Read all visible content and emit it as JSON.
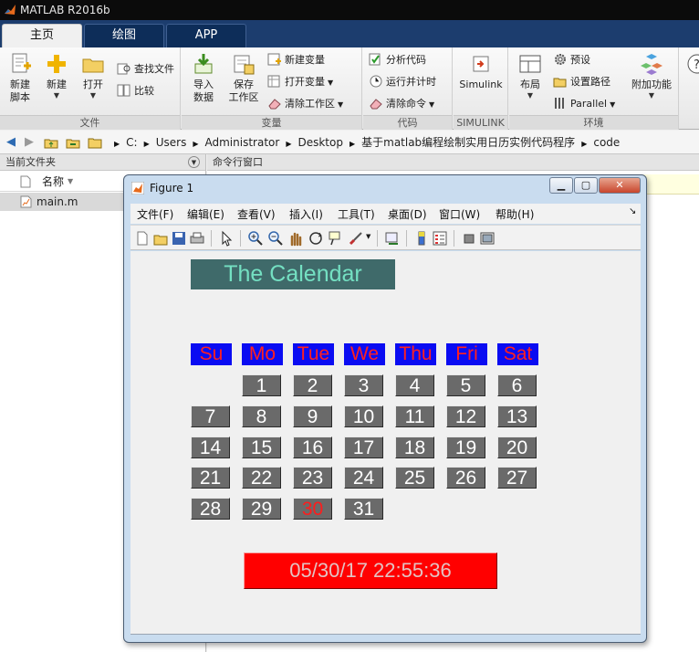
{
  "app": {
    "title": "MATLAB R2016b"
  },
  "ribbon": {
    "tabs": [
      {
        "label": "主页",
        "active": true
      },
      {
        "label": "绘图",
        "active": false
      },
      {
        "label": "APP",
        "active": false
      }
    ],
    "groups": {
      "file": {
        "label": "文件",
        "new_script": "新建\n脚本",
        "new": "新建",
        "open": "打开",
        "find_files": "查找文件",
        "compare": "比较"
      },
      "variable": {
        "label": "变量",
        "import": "导入\n数据",
        "save": "保存\n工作区",
        "new_var": "新建变量",
        "open_var": "打开变量",
        "clear_ws": "清除工作区"
      },
      "code": {
        "label": "代码",
        "analyze": "分析代码",
        "run_time": "运行并计时",
        "clear_cmd": "清除命令"
      },
      "simulink": {
        "label": "SIMULINK",
        "simulink": "Simulink"
      },
      "environment": {
        "label": "环境",
        "layout": "布局",
        "preferences": "预设",
        "set_path": "设置路径",
        "parallel": "Parallel",
        "addons": "附加功能"
      }
    }
  },
  "address": {
    "crumbs": [
      "C:",
      "Users",
      "Administrator",
      "Desktop",
      "基于matlab编程绘制实用日历实例代码程序",
      "code"
    ]
  },
  "current_folder": {
    "title": "当前文件夹",
    "column_name": "名称",
    "files": [
      {
        "name": "main.m"
      }
    ]
  },
  "command_window": {
    "title": "命令行窗口"
  },
  "figure": {
    "title": "Figure 1",
    "menu": [
      "文件(F)",
      "编辑(E)",
      "查看(V)",
      "插入(I)",
      "工具(T)",
      "桌面(D)",
      "窗口(W)",
      "帮助(H)"
    ],
    "calendar": {
      "title": "The Calendar",
      "weekdays": [
        "Su",
        "Mo",
        "Tue",
        "We",
        "Thu",
        "Fri",
        "Sat"
      ],
      "first_weekday_index": 1,
      "days_in_month": 31,
      "today": 30,
      "datetime": "05/30/17 22:55:36"
    }
  },
  "colors": {
    "ribbon_tab_bg": "#1c3d6e",
    "weekday_header_bg": "#0a0cf2",
    "weekday_header_text": "#ff2020",
    "day_cell_bg": "#6a6a6a",
    "today_text": "#ff1c1c",
    "clock_bg": "#ff0000",
    "calendar_title_bg": "#3f6a6a",
    "calendar_title_text": "#74e0c2"
  }
}
